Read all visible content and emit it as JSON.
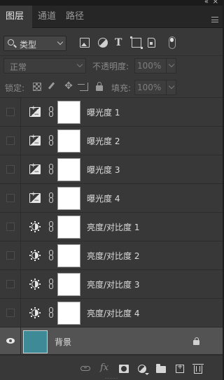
{
  "tabs": [
    {
      "label": "图层",
      "active": true
    },
    {
      "label": "通道",
      "active": false
    },
    {
      "label": "路径",
      "active": false
    }
  ],
  "filter": {
    "kind_label": "类型",
    "icons": [
      "pixel-layer-filter-icon",
      "adjustment-layer-filter-icon",
      "type-layer-filter-icon",
      "shape-layer-filter-icon",
      "smart-object-filter-icon"
    ]
  },
  "blend": {
    "mode_label": "正常",
    "opacity_label": "不透明度:",
    "opacity_value": "100%"
  },
  "lock": {
    "label": "锁定:",
    "fill_label": "填充:",
    "fill_value": "100%"
  },
  "layers": [
    {
      "name": "曝光度 1",
      "type": "exposure",
      "visible": false
    },
    {
      "name": "曝光度 2",
      "type": "exposure",
      "visible": false
    },
    {
      "name": "曝光度 3",
      "type": "exposure",
      "visible": false
    },
    {
      "name": "曝光度 4",
      "type": "exposure",
      "visible": false
    },
    {
      "name": "亮度/对比度 1",
      "type": "brightness-contrast",
      "visible": false
    },
    {
      "name": "亮度/对比度 2",
      "type": "brightness-contrast",
      "visible": false
    },
    {
      "name": "亮度/对比度 3",
      "type": "brightness-contrast",
      "visible": false
    },
    {
      "name": "亮度/对比度 4",
      "type": "brightness-contrast",
      "visible": false
    }
  ],
  "background_layer": {
    "name": "背景",
    "visible": true,
    "selected": true,
    "thumb_color": "#3f8a97"
  },
  "colors": {
    "panel_bg": "#383838",
    "selected_row": "#535353",
    "tab_bar": "#262626"
  }
}
